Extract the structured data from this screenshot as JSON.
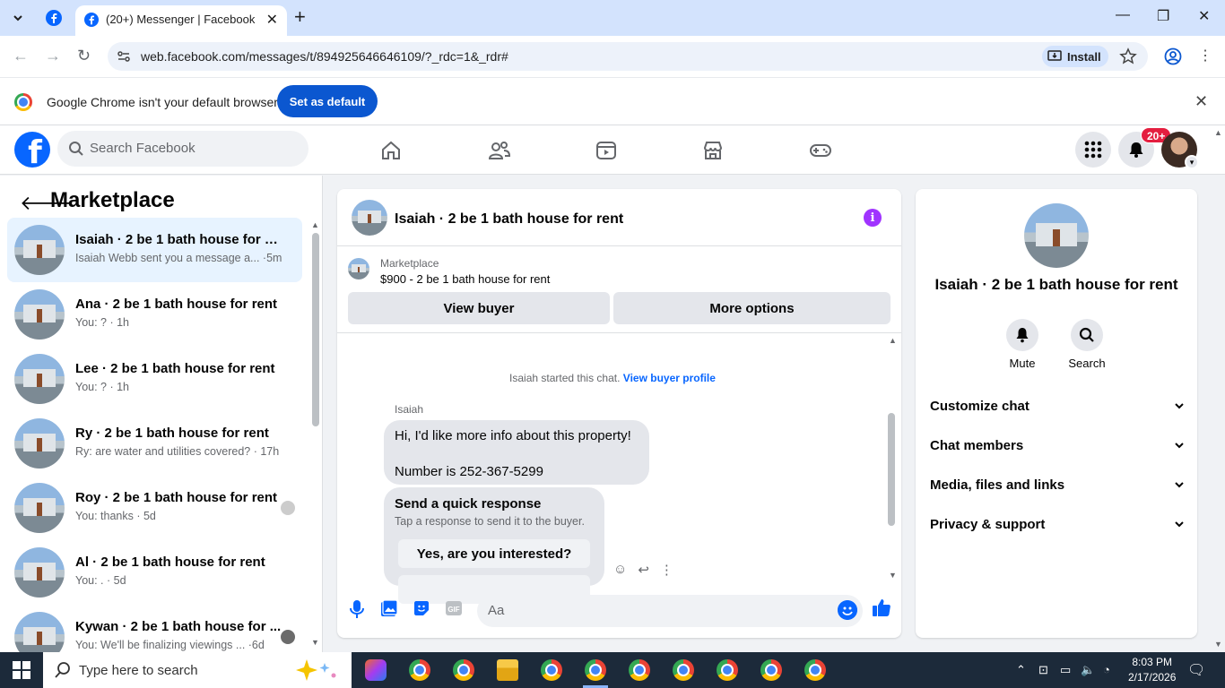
{
  "browser": {
    "tab_title": "(20+) Messenger | Facebook",
    "url": "web.facebook.com/messages/t/894925646646109/?_rdc=1&_rdr#",
    "install_label": "Install",
    "infobar_message": "Google Chrome isn't your default browser",
    "set_default_label": "Set as default"
  },
  "facebook": {
    "search_placeholder": "Search Facebook",
    "notification_badge": "20+",
    "colors": {
      "brand": "#0866ff",
      "badge": "#e41e3f",
      "info": "#a033ff"
    }
  },
  "sidebar": {
    "title": "Marketplace",
    "conversations": [
      {
        "name": "Isaiah · 2 be 1 bath house for rent",
        "snippet": "Isaiah Webb sent you a message a... ·5m",
        "active": true
      },
      {
        "name": "Ana · 2 be 1 bath house for rent",
        "snippet": "You: ? · 1h"
      },
      {
        "name": "Lee · 2 be 1 bath house for rent",
        "snippet": "You: ? · 1h"
      },
      {
        "name": "Ry · 2 be 1 bath house for rent",
        "snippet": "Ry: are water and utilities covered? · 17h"
      },
      {
        "name": "Roy · 2 be 1 bath house for rent",
        "snippet": "You: thanks · 5d"
      },
      {
        "name": "Al · 2 be 1 bath house for rent",
        "snippet": "You: . · 5d"
      },
      {
        "name": "Kywan · 2 be 1 bath house for ...",
        "snippet": "You: We'll be finalizing viewings ... ·6d"
      }
    ]
  },
  "chat": {
    "header_name": "Isaiah · 2 be 1 bath house for rent",
    "listing_label": "Marketplace",
    "listing_price": "$900 - 2 be 1 bath house for rent",
    "view_buyer_label": "View buyer",
    "more_options_label": "More options",
    "system_message": "Isaiah started this chat.",
    "view_buyer_profile": "View buyer profile",
    "sender": "Isaiah",
    "message_line1": "Hi, I'd like more info about this property!",
    "message_line2": "Number is 252-367-5299",
    "quick_title": "Send a quick response",
    "quick_subtitle": "Tap a response to send it to the buyer.",
    "quick_option1": "Yes, are you interested?",
    "composer_placeholder": "Aa"
  },
  "right_panel": {
    "name": "Isaiah · 2 be 1 bath house for rent",
    "mute_label": "Mute",
    "search_label": "Search",
    "rows": [
      "Customize chat",
      "Chat members",
      "Media, files and links",
      "Privacy & support"
    ]
  },
  "taskbar": {
    "search_placeholder": "Type here to search",
    "time": "8:03 PM",
    "date": "2/17/2026"
  }
}
